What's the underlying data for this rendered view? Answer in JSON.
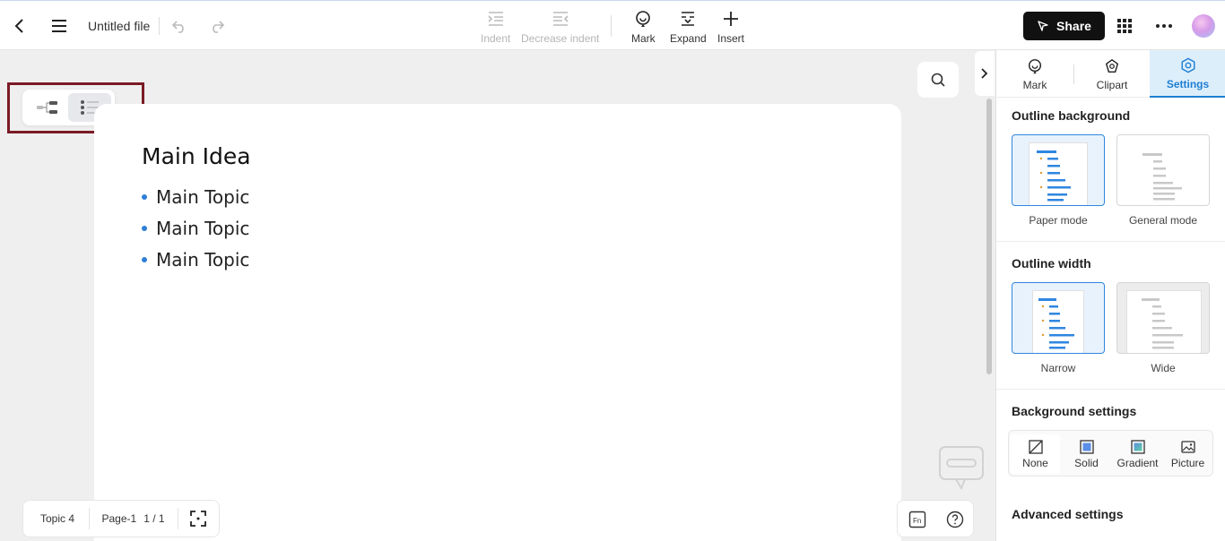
{
  "header": {
    "file_title": "Untitled file",
    "tools": [
      {
        "label": "Indent",
        "icon": "indent-icon",
        "disabled": true
      },
      {
        "label": "Decrease indent",
        "icon": "decrease-indent-icon",
        "disabled": true
      },
      {
        "label": "Mark",
        "icon": "smiley-icon",
        "disabled": false
      },
      {
        "label": "Expand",
        "icon": "expand-icon",
        "disabled": false
      },
      {
        "label": "Insert",
        "icon": "plus-icon",
        "disabled": false
      }
    ],
    "share_label": "Share"
  },
  "view_switch": {
    "active": "outline"
  },
  "document": {
    "main_idea": "Main Idea",
    "topics": [
      "Main Topic",
      "Main Topic",
      "Main Topic"
    ]
  },
  "status": {
    "topic_count": "Topic 4",
    "page_name": "Page-1",
    "page_num": "1 / 1"
  },
  "panel": {
    "tabs": [
      {
        "label": "Mark",
        "icon": "smiley-icon"
      },
      {
        "label": "Clipart",
        "icon": "clipart-icon"
      },
      {
        "label": "Settings",
        "icon": "settings-icon",
        "active": true
      }
    ],
    "outline_background": {
      "title": "Outline background",
      "options": [
        {
          "label": "Paper mode",
          "selected": true
        },
        {
          "label": "General mode",
          "selected": false
        }
      ]
    },
    "outline_width": {
      "title": "Outline width",
      "options": [
        {
          "label": "Narrow",
          "selected": true
        },
        {
          "label": "Wide",
          "selected": false
        }
      ]
    },
    "background_settings": {
      "title": "Background settings",
      "options": [
        {
          "label": "None",
          "selected": true
        },
        {
          "label": "Solid",
          "selected": false
        },
        {
          "label": "Gradient",
          "selected": false
        },
        {
          "label": "Picture",
          "selected": false
        }
      ]
    },
    "advanced_settings": {
      "title": "Advanced settings"
    }
  },
  "colors": {
    "accent": "#1e7fd3",
    "share_bg": "#111111",
    "highlight_border": "#7a1b25",
    "bullet": "#2f7fd6"
  }
}
